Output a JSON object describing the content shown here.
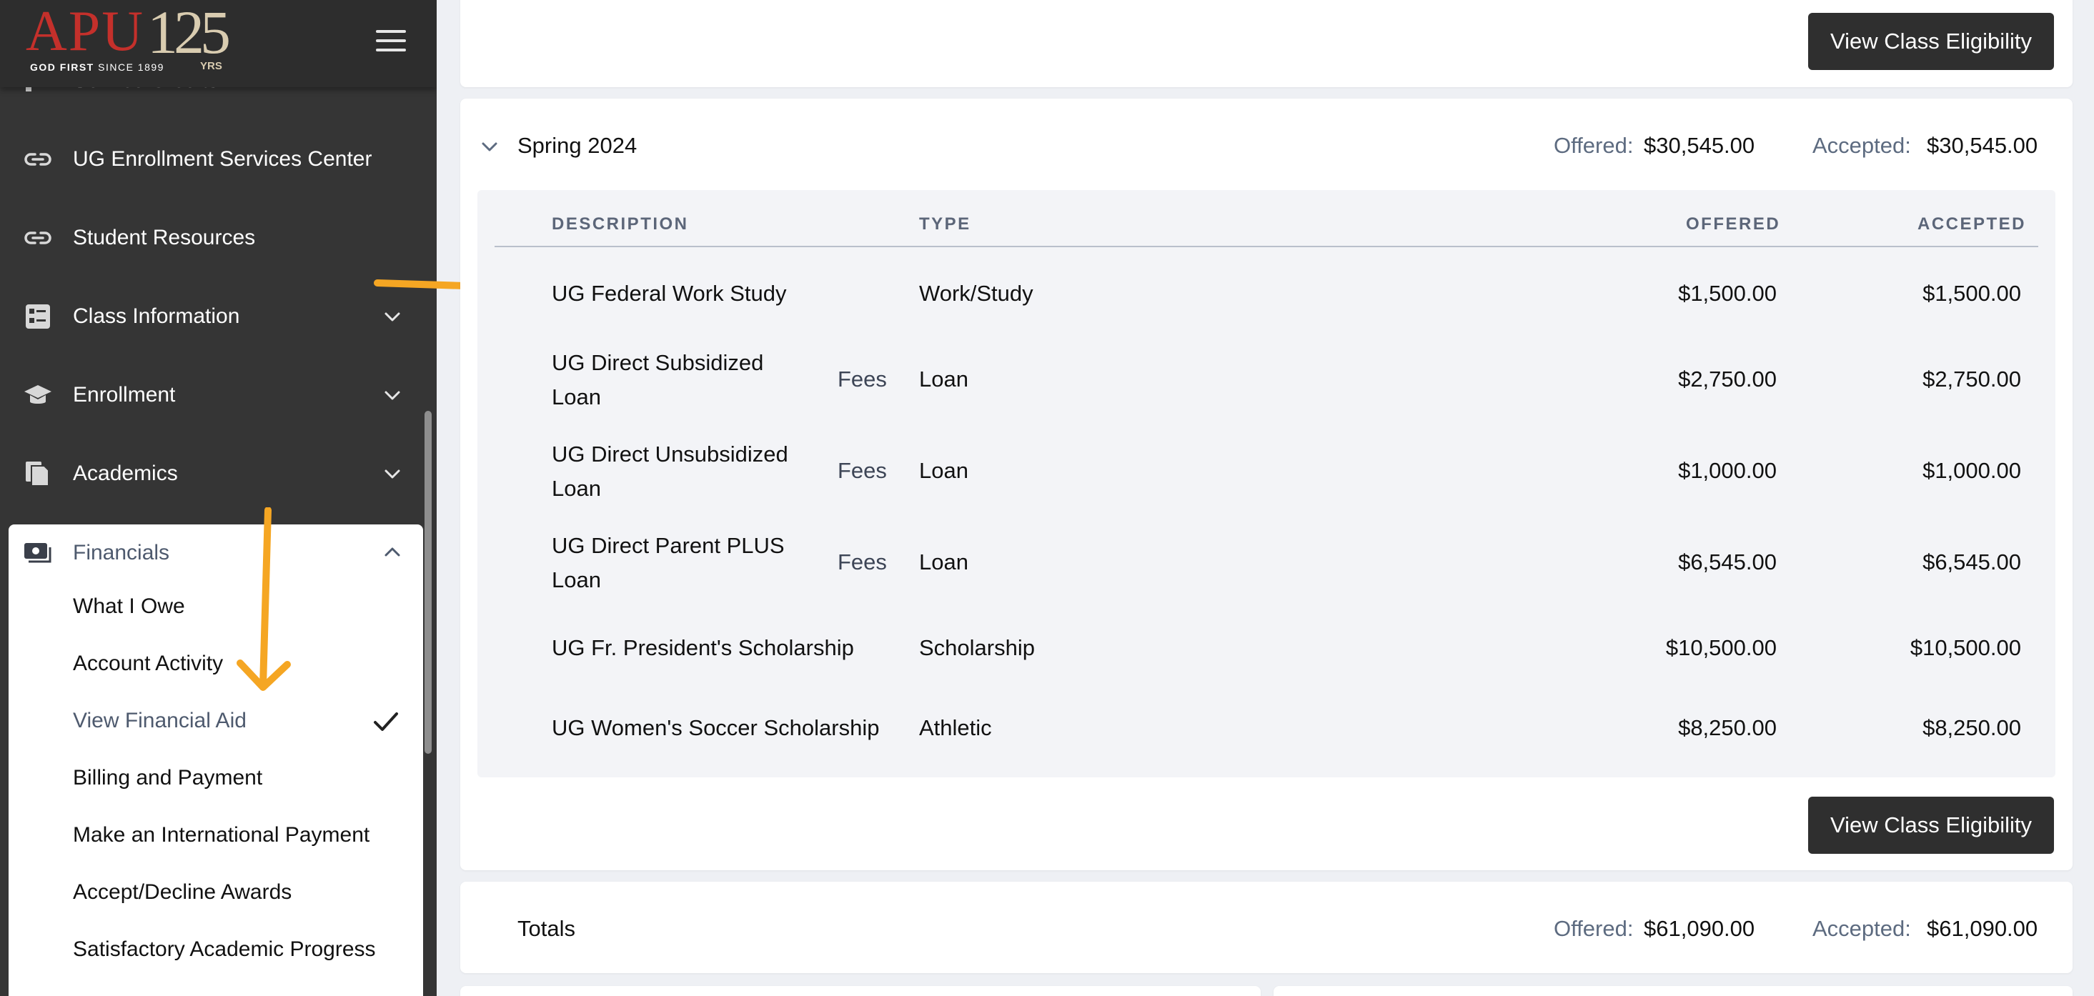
{
  "brand": {
    "logo_text": "APU",
    "logo_number": "125",
    "logo_yrs": "YRS",
    "logo_tagline_bold": "GOD FIRST",
    "logo_tagline_rest": " SINCE 1899"
  },
  "sidebar": {
    "cut_item": "Service Credits",
    "items": [
      {
        "label": "UG Enrollment Services Center",
        "icon": "link-icon"
      },
      {
        "label": "Student Resources",
        "icon": "link-icon"
      },
      {
        "label": "Class Information",
        "icon": "list-icon",
        "expandable": true
      },
      {
        "label": "Enrollment",
        "icon": "graduation-cap-icon",
        "expandable": true
      },
      {
        "label": "Academics",
        "icon": "document-icon",
        "expandable": true
      }
    ],
    "financials": {
      "label": "Financials",
      "icon": "money-icon",
      "expanded": true,
      "sub_items": [
        {
          "label": "What I Owe"
        },
        {
          "label": "Account Activity"
        },
        {
          "label": "View Financial Aid",
          "selected": true
        },
        {
          "label": "Billing and Payment"
        },
        {
          "label": "Make an International Payment"
        },
        {
          "label": "Accept/Decline Awards"
        },
        {
          "label": "Satisfactory Academic Progress"
        }
      ]
    }
  },
  "main": {
    "top_button": "View Class Eligibility",
    "term": {
      "title": "Spring 2024",
      "offered_label": "Offered:",
      "offered_value": "$30,545.00",
      "accepted_label": "Accepted:",
      "accepted_value": "$30,545.00",
      "columns": [
        "DESCRIPTION",
        "TYPE",
        "OFFERED",
        "ACCEPTED"
      ],
      "rows": [
        {
          "description": "UG Federal Work Study",
          "fees": "",
          "type": "Work/Study",
          "offered": "$1,500.00",
          "accepted": "$1,500.00"
        },
        {
          "description": "UG Direct Subsidized Loan",
          "fees": "Fees",
          "type": "Loan",
          "offered": "$2,750.00",
          "accepted": "$2,750.00"
        },
        {
          "description": "UG Direct Unsubsidized Loan",
          "fees": "Fees",
          "type": "Loan",
          "offered": "$1,000.00",
          "accepted": "$1,000.00"
        },
        {
          "description": "UG Direct Parent PLUS Loan",
          "fees": "Fees",
          "type": "Loan",
          "offered": "$6,545.00",
          "accepted": "$6,545.00"
        },
        {
          "description": "UG Fr. President's Scholarship",
          "fees": "",
          "type": "Scholarship",
          "offered": "$10,500.00",
          "accepted": "$10,500.00"
        },
        {
          "description": "UG Women's Soccer Scholarship",
          "fees": "",
          "type": "Athletic",
          "offered": "$8,250.00",
          "accepted": "$8,250.00"
        }
      ],
      "button": "View Class Eligibility"
    },
    "totals": {
      "label": "Totals",
      "offered_label": "Offered:",
      "offered_value": "$61,090.00",
      "accepted_label": "Accepted:",
      "accepted_value": "$61,090.00"
    }
  },
  "colors": {
    "sidebar_bg": "#353535",
    "accent_arrow": "#f5a623",
    "brand_red": "#c4302b",
    "button_dark": "#2f2f2f",
    "muted_label": "#5d6b80"
  }
}
